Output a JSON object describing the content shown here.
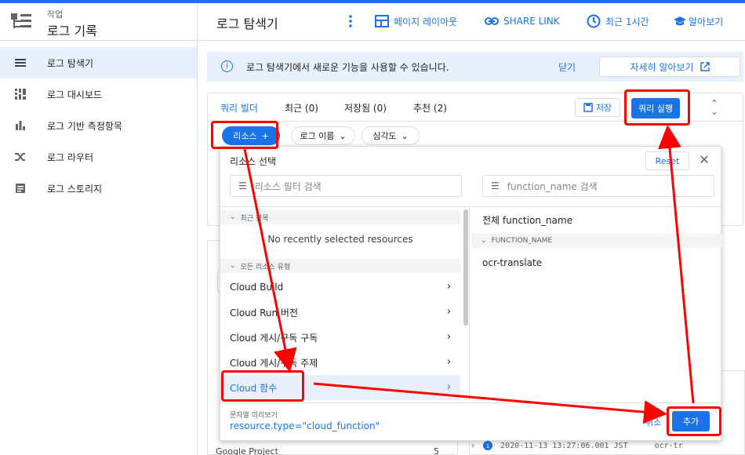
{
  "app": {
    "subtitle": "작업",
    "title": "로그 기록"
  },
  "nav": {
    "items": [
      {
        "label": "로그 탐색기",
        "icon": "list-icon"
      },
      {
        "label": "로그 대시보드",
        "icon": "dashboard-icon"
      },
      {
        "label": "로그 기반 측정항목",
        "icon": "bar-chart-icon"
      },
      {
        "label": "로그 라우터",
        "icon": "shuffle-icon"
      },
      {
        "label": "로그 스토리지",
        "icon": "storage-icon"
      }
    ]
  },
  "header": {
    "title": "로그 탐색기",
    "layout": "페이지 레이아웃",
    "share": "SHARE LINK",
    "time": "최근 1시간",
    "learn": "알아보기"
  },
  "banner": {
    "text": "로그 탐색기에서 새로운 기능을 사용할 수 있습니다.",
    "close": "닫기",
    "more": "자세히 알아보기"
  },
  "query": {
    "tabs": [
      "쿼리 빌더",
      "최근 (0)",
      "저장됨 (0)",
      "추천 (2)"
    ],
    "save": "저장",
    "run": "쿼리 실행",
    "chips": {
      "resource": "리소스",
      "logname": "로그 이름",
      "severity": "심각도"
    }
  },
  "panel": {
    "title": "리소스 선택",
    "reset": "Reset",
    "resource_filter_placeholder": "리소스 필터 검색",
    "fn_filter_placeholder": "function_name 검색",
    "recent_header": "최근 항목",
    "no_recent": "No recently selected resources",
    "all_header": "모든 리소스 유형",
    "resources": [
      "Cloud Build",
      "Cloud Run 버전",
      "Cloud 게시/구독 구독",
      "Cloud 게시/구독 주제",
      "Cloud 함수"
    ],
    "all_fn": "전체 function_name",
    "fn_header": "FUNCTION_NAME",
    "fn_items": [
      "ocr-translate"
    ],
    "preview_label": "문자열 미리보기",
    "preview_value": "resource.type=\"cloud_function\"",
    "cancel": "취소",
    "add": "추가"
  },
  "background": {
    "project_label": "Google Project",
    "project_count": "5",
    "log_timestamp": "2020-11-13 13:27:06.001 JST",
    "log_fn": "ocr-tr"
  },
  "colors": {
    "accent": "#1a73e8",
    "annotation": "#ff0000"
  }
}
